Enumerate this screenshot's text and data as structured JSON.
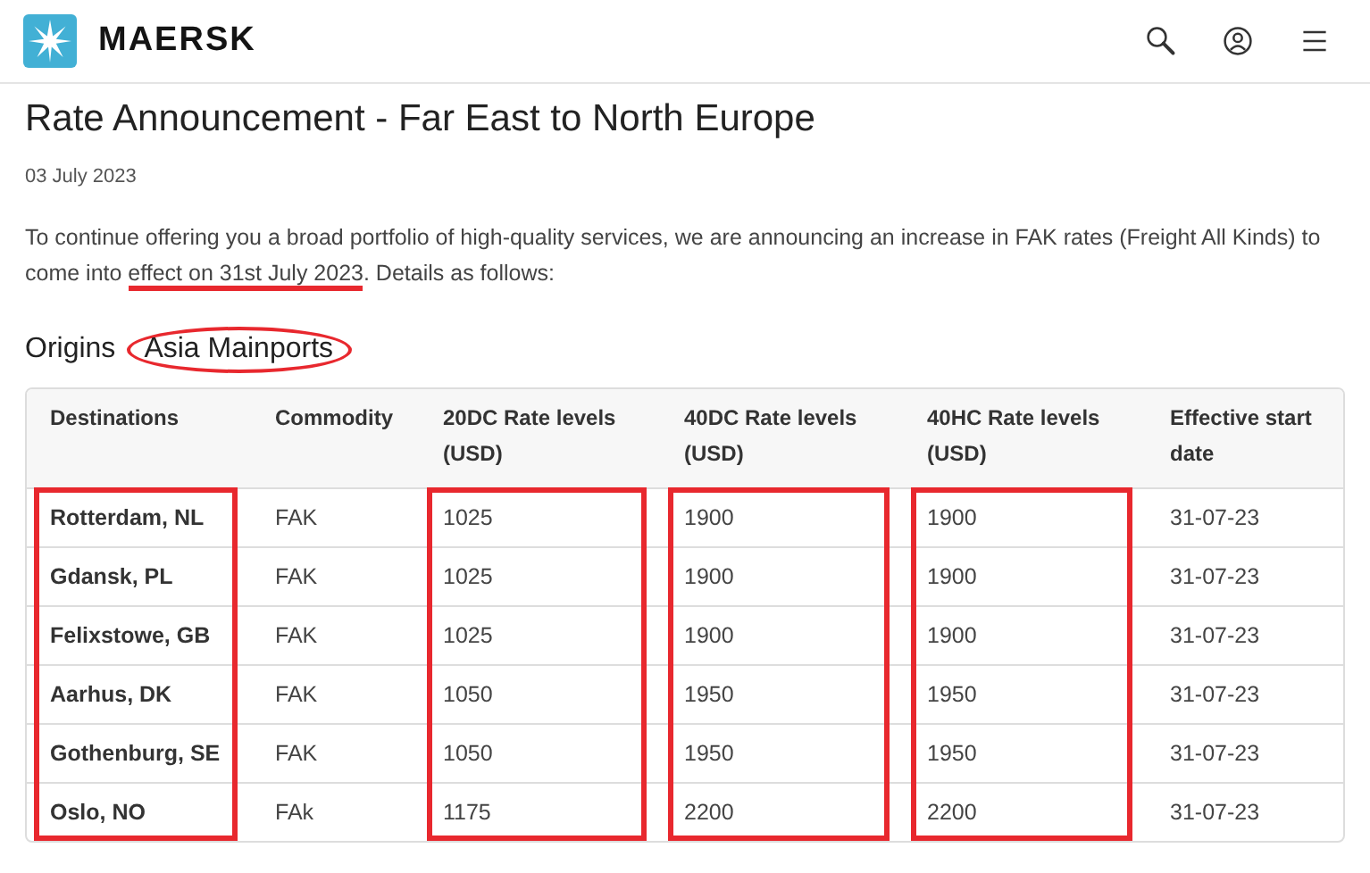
{
  "header": {
    "brand": "MAERSK"
  },
  "title": "Rate Announcement - Far East to North Europe",
  "date": "03 July 2023",
  "intro": [
    {
      "text": "To continue offering you a broad portfolio of high-quality services, we are announcing an increase in FAK rates (Freight All Kinds) to come into ",
      "marked": false
    },
    {
      "text": "effect on 31st July 2023",
      "marked": true
    },
    {
      "text": ". Details as follows:",
      "marked": false
    }
  ],
  "origins": {
    "label": "Origins",
    "value": "Asia Mainports",
    "value_marked": true
  },
  "table": {
    "columns": [
      {
        "label": "Destinations",
        "marked": true
      },
      {
        "label": "Commodity",
        "marked": false
      },
      {
        "label": "20DC Rate levels (USD)",
        "marked": true
      },
      {
        "label": "40DC Rate levels (USD)",
        "marked": true
      },
      {
        "label": "40HC Rate levels (USD)",
        "marked": true
      },
      {
        "label": "Effective start date",
        "marked": false
      }
    ],
    "rows": [
      [
        "Rotterdam, NL",
        "FAK",
        "1025",
        "1900",
        "1900",
        "31-07-23"
      ],
      [
        "Gdansk, PL",
        "FAK",
        "1025",
        "1900",
        "1900",
        "31-07-23"
      ],
      [
        "Felixstowe, GB",
        "FAK",
        "1025",
        "1900",
        "1900",
        "31-07-23"
      ],
      [
        "Aarhus, DK",
        "FAK",
        "1050",
        "1950",
        "1950",
        "31-07-23"
      ],
      [
        "Gothenburg, SE",
        "FAK",
        "1050",
        "1950",
        "1950",
        "31-07-23"
      ],
      [
        "Oslo, NO",
        "FAk",
        "1175",
        "2200",
        "2200",
        "31-07-23"
      ]
    ]
  }
}
